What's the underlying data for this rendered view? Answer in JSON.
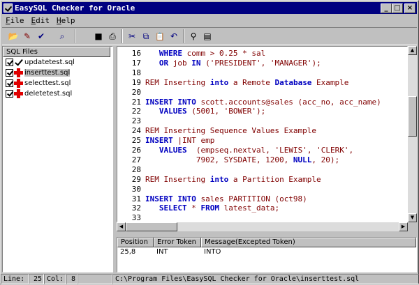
{
  "window": {
    "title": "EasySQL Checker for Oracle"
  },
  "caption_buttons": {
    "minimize": "_",
    "maximize": "□",
    "close": "×"
  },
  "menu": {
    "items": [
      {
        "key": "F",
        "rest": "ile"
      },
      {
        "key": "E",
        "rest": "dit"
      },
      {
        "key": "H",
        "rest": "elp"
      }
    ]
  },
  "toolbar": {
    "icons": [
      "open-folder-icon",
      "edit-icon",
      "check-icon",
      "find-window-icon",
      "save-icon",
      "print-icon",
      "cut-icon",
      "copy-icon",
      "paste-icon",
      "undo-icon",
      "binoculars-icon",
      "replace-icon"
    ],
    "glyphs": {
      "open": "📂",
      "edit": "✎",
      "check": "✔",
      "findwin": "⌕",
      "save": "■",
      "print": "⎙",
      "cut": "✂",
      "copy": "⧉",
      "paste": "📋",
      "undo": "↶",
      "find": "⚲",
      "replace": "▤"
    }
  },
  "sql_files": {
    "header": "SQL Files",
    "items": [
      {
        "name": "updatetest.sql",
        "status": "ok",
        "selected": false
      },
      {
        "name": "inserttest.sql",
        "status": "error",
        "selected": true
      },
      {
        "name": "selecttest.sql",
        "status": "error",
        "selected": false
      },
      {
        "name": "deletetest.sql",
        "status": "error",
        "selected": false
      }
    ]
  },
  "editor": {
    "lines": [
      {
        "num": "16",
        "parts": [
          [
            "p",
            "   "
          ],
          [
            "kw",
            "WHERE"
          ],
          [
            "p",
            " comm > 0.25 * sal"
          ]
        ]
      },
      {
        "num": "17",
        "parts": [
          [
            "p",
            "   "
          ],
          [
            "kw",
            "OR"
          ],
          [
            "p",
            " job "
          ],
          [
            "kw",
            "IN"
          ],
          [
            "p",
            " ("
          ],
          [
            "str",
            "'PRESIDENT'"
          ],
          [
            "p",
            ", "
          ],
          [
            "str",
            "'MANAGER'"
          ],
          [
            "p",
            ");"
          ]
        ]
      },
      {
        "num": "18",
        "parts": []
      },
      {
        "num": "19",
        "parts": [
          [
            "rem",
            "REM Inserting "
          ],
          [
            "kw",
            "into"
          ],
          [
            "rem",
            " a Remote "
          ],
          [
            "kw",
            "Database"
          ],
          [
            "rem",
            " Example"
          ]
        ]
      },
      {
        "num": "20",
        "parts": []
      },
      {
        "num": "21",
        "parts": [
          [
            "kw",
            "INSERT INTO"
          ],
          [
            "p",
            " scott.accounts@sales (acc_no, acc_name)"
          ]
        ]
      },
      {
        "num": "22",
        "parts": [
          [
            "p",
            "   "
          ],
          [
            "kw",
            "VALUES"
          ],
          [
            "p",
            " (5001, "
          ],
          [
            "str",
            "'BOWER'"
          ],
          [
            "p",
            ");"
          ]
        ]
      },
      {
        "num": "23",
        "parts": []
      },
      {
        "num": "24",
        "parts": [
          [
            "rem",
            "REM Inserting Sequence Values Example"
          ]
        ]
      },
      {
        "num": "25",
        "parts": [
          [
            "kw",
            "INSERT"
          ],
          [
            "p",
            " |INT emp"
          ]
        ]
      },
      {
        "num": "26",
        "parts": [
          [
            "p",
            "   "
          ],
          [
            "kw",
            "VALUES"
          ],
          [
            "p",
            "  (empseq.nextval, "
          ],
          [
            "str",
            "'LEWIS'"
          ],
          [
            "p",
            ", "
          ],
          [
            "str",
            "'CLERK'"
          ],
          [
            "p",
            ","
          ]
        ]
      },
      {
        "num": "27",
        "parts": [
          [
            "p",
            "           7902, SYSDATE, 1200, "
          ],
          [
            "kw",
            "NULL"
          ],
          [
            "p",
            ", 20);"
          ]
        ]
      },
      {
        "num": "28",
        "parts": []
      },
      {
        "num": "29",
        "parts": [
          [
            "rem",
            "REM Inserting "
          ],
          [
            "kw",
            "into"
          ],
          [
            "rem",
            " a Partition Example"
          ]
        ]
      },
      {
        "num": "30",
        "parts": []
      },
      {
        "num": "31",
        "parts": [
          [
            "kw",
            "INSERT INTO"
          ],
          [
            "p",
            " sales PARTITION (oct98)"
          ]
        ]
      },
      {
        "num": "32",
        "parts": [
          [
            "p",
            "   "
          ],
          [
            "kw",
            "SELECT"
          ],
          [
            "p",
            " * "
          ],
          [
            "kw",
            "FROM"
          ],
          [
            "p",
            " latest_data;"
          ]
        ]
      },
      {
        "num": "33",
        "parts": []
      }
    ]
  },
  "scroll": {
    "up": "▲",
    "down": "▼",
    "left": "◀",
    "right": "▶"
  },
  "errors": {
    "columns": [
      "Position",
      "Error Token",
      "Message(Excepted Token)"
    ],
    "rows": [
      {
        "position": "25,8",
        "token": "INT",
        "message": "INTO"
      }
    ]
  },
  "status": {
    "line_label": "Line:",
    "line_value": "25",
    "col_label": "Col:",
    "col_value": "8",
    "path": "C:\\Program Files\\EasySQL Checker for Oracle\\inserttest.sql"
  }
}
